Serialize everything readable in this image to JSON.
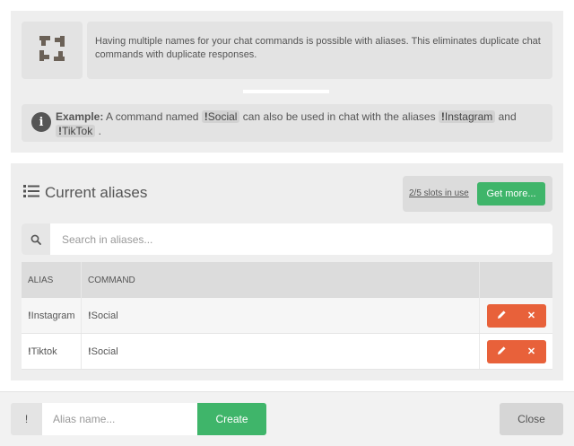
{
  "intro": {
    "icon": "refresh-arrows-icon",
    "text": "Having multiple names for your chat commands is possible with aliases. This eliminates duplicate chat commands with duplicate responses."
  },
  "example": {
    "icon": "info-icon",
    "label": "Example:",
    "text_before": " A command named ",
    "command_bang": "!",
    "command_name": "Social",
    "text_middle": " can also be used in chat with the aliases ",
    "alias1_bang": "!",
    "alias1_name": "Instagram",
    "text_and": " and ",
    "alias2_bang": "!",
    "alias2_name": "TikTok",
    "text_end": " ."
  },
  "aliases": {
    "title": "Current aliases",
    "title_icon": "list-icon",
    "slots_text": "2/5 slots in use",
    "get_more_label": "Get more...",
    "search_placeholder": "Search in aliases...",
    "columns": {
      "alias": "ALIAS",
      "command": "COMMAND"
    },
    "rows": [
      {
        "alias_bang": "!",
        "alias": "Instagram",
        "command_bang": "!",
        "command": "Social"
      },
      {
        "alias_bang": "!",
        "alias": "Tiktok",
        "command_bang": "!",
        "command": "Social"
      }
    ],
    "edit_icon": "pencil-icon",
    "delete_icon": "close-icon",
    "delete_glyph": "✕"
  },
  "footer": {
    "prefix": "!",
    "alias_placeholder": "Alias name...",
    "create_label": "Create",
    "close_label": "Close"
  },
  "colors": {
    "green": "#3fb56a",
    "orange": "#e8613a",
    "panel": "#eeeeee"
  }
}
